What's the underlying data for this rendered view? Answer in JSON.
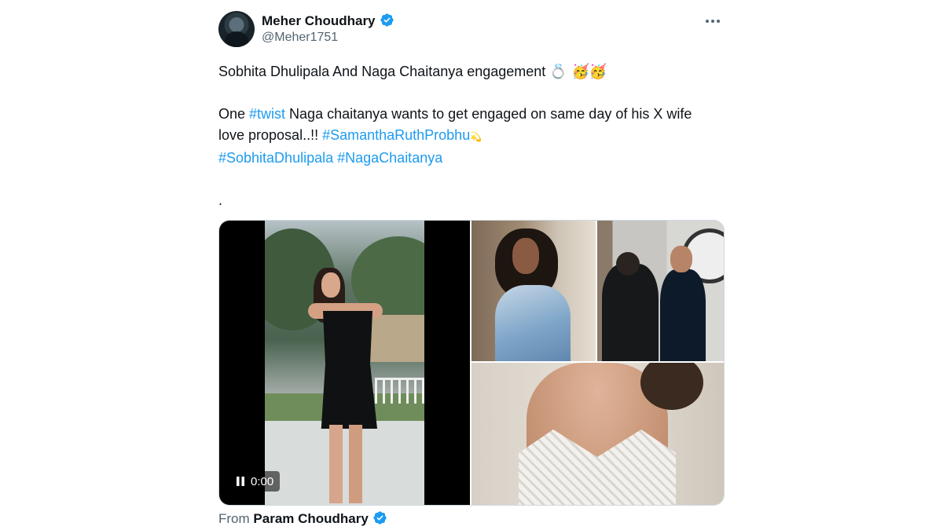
{
  "author": {
    "name": "Meher Choudhary",
    "handle": "@Meher1751",
    "verified": true
  },
  "colors": {
    "text": "#0f1419",
    "secondary_text": "#536471",
    "hashtag": "#1d9bf0",
    "verified_badge": "#1d9bf0",
    "border": "#cfd9de"
  },
  "tweet": {
    "line1": "Sobhita Dhulipala And Naga Chaitanya engagement",
    "line1_emoji": "💍 🥳🥳",
    "p2_before": "One ",
    "p2_tag_twist": "#twist",
    "p2_after": " Naga chaitanya wants to get engaged on same day of his X wife love proposal..!! ",
    "p2_tag_samantha": "#SamanthaRuthProbhu",
    "p2_emoji": "💫",
    "p2_tag_sobhita": "#SobhitaDhulipala",
    "p2_tag_naga": "#NagaChaitanya",
    "trailing_dot": "."
  },
  "media": {
    "video_time": "0:00",
    "video_icon": "pause-icon",
    "items": [
      "video",
      "photo",
      "photo",
      "photo"
    ]
  },
  "footer": {
    "from_label": "From",
    "from_name": "Param Choudhary",
    "from_verified": true
  }
}
